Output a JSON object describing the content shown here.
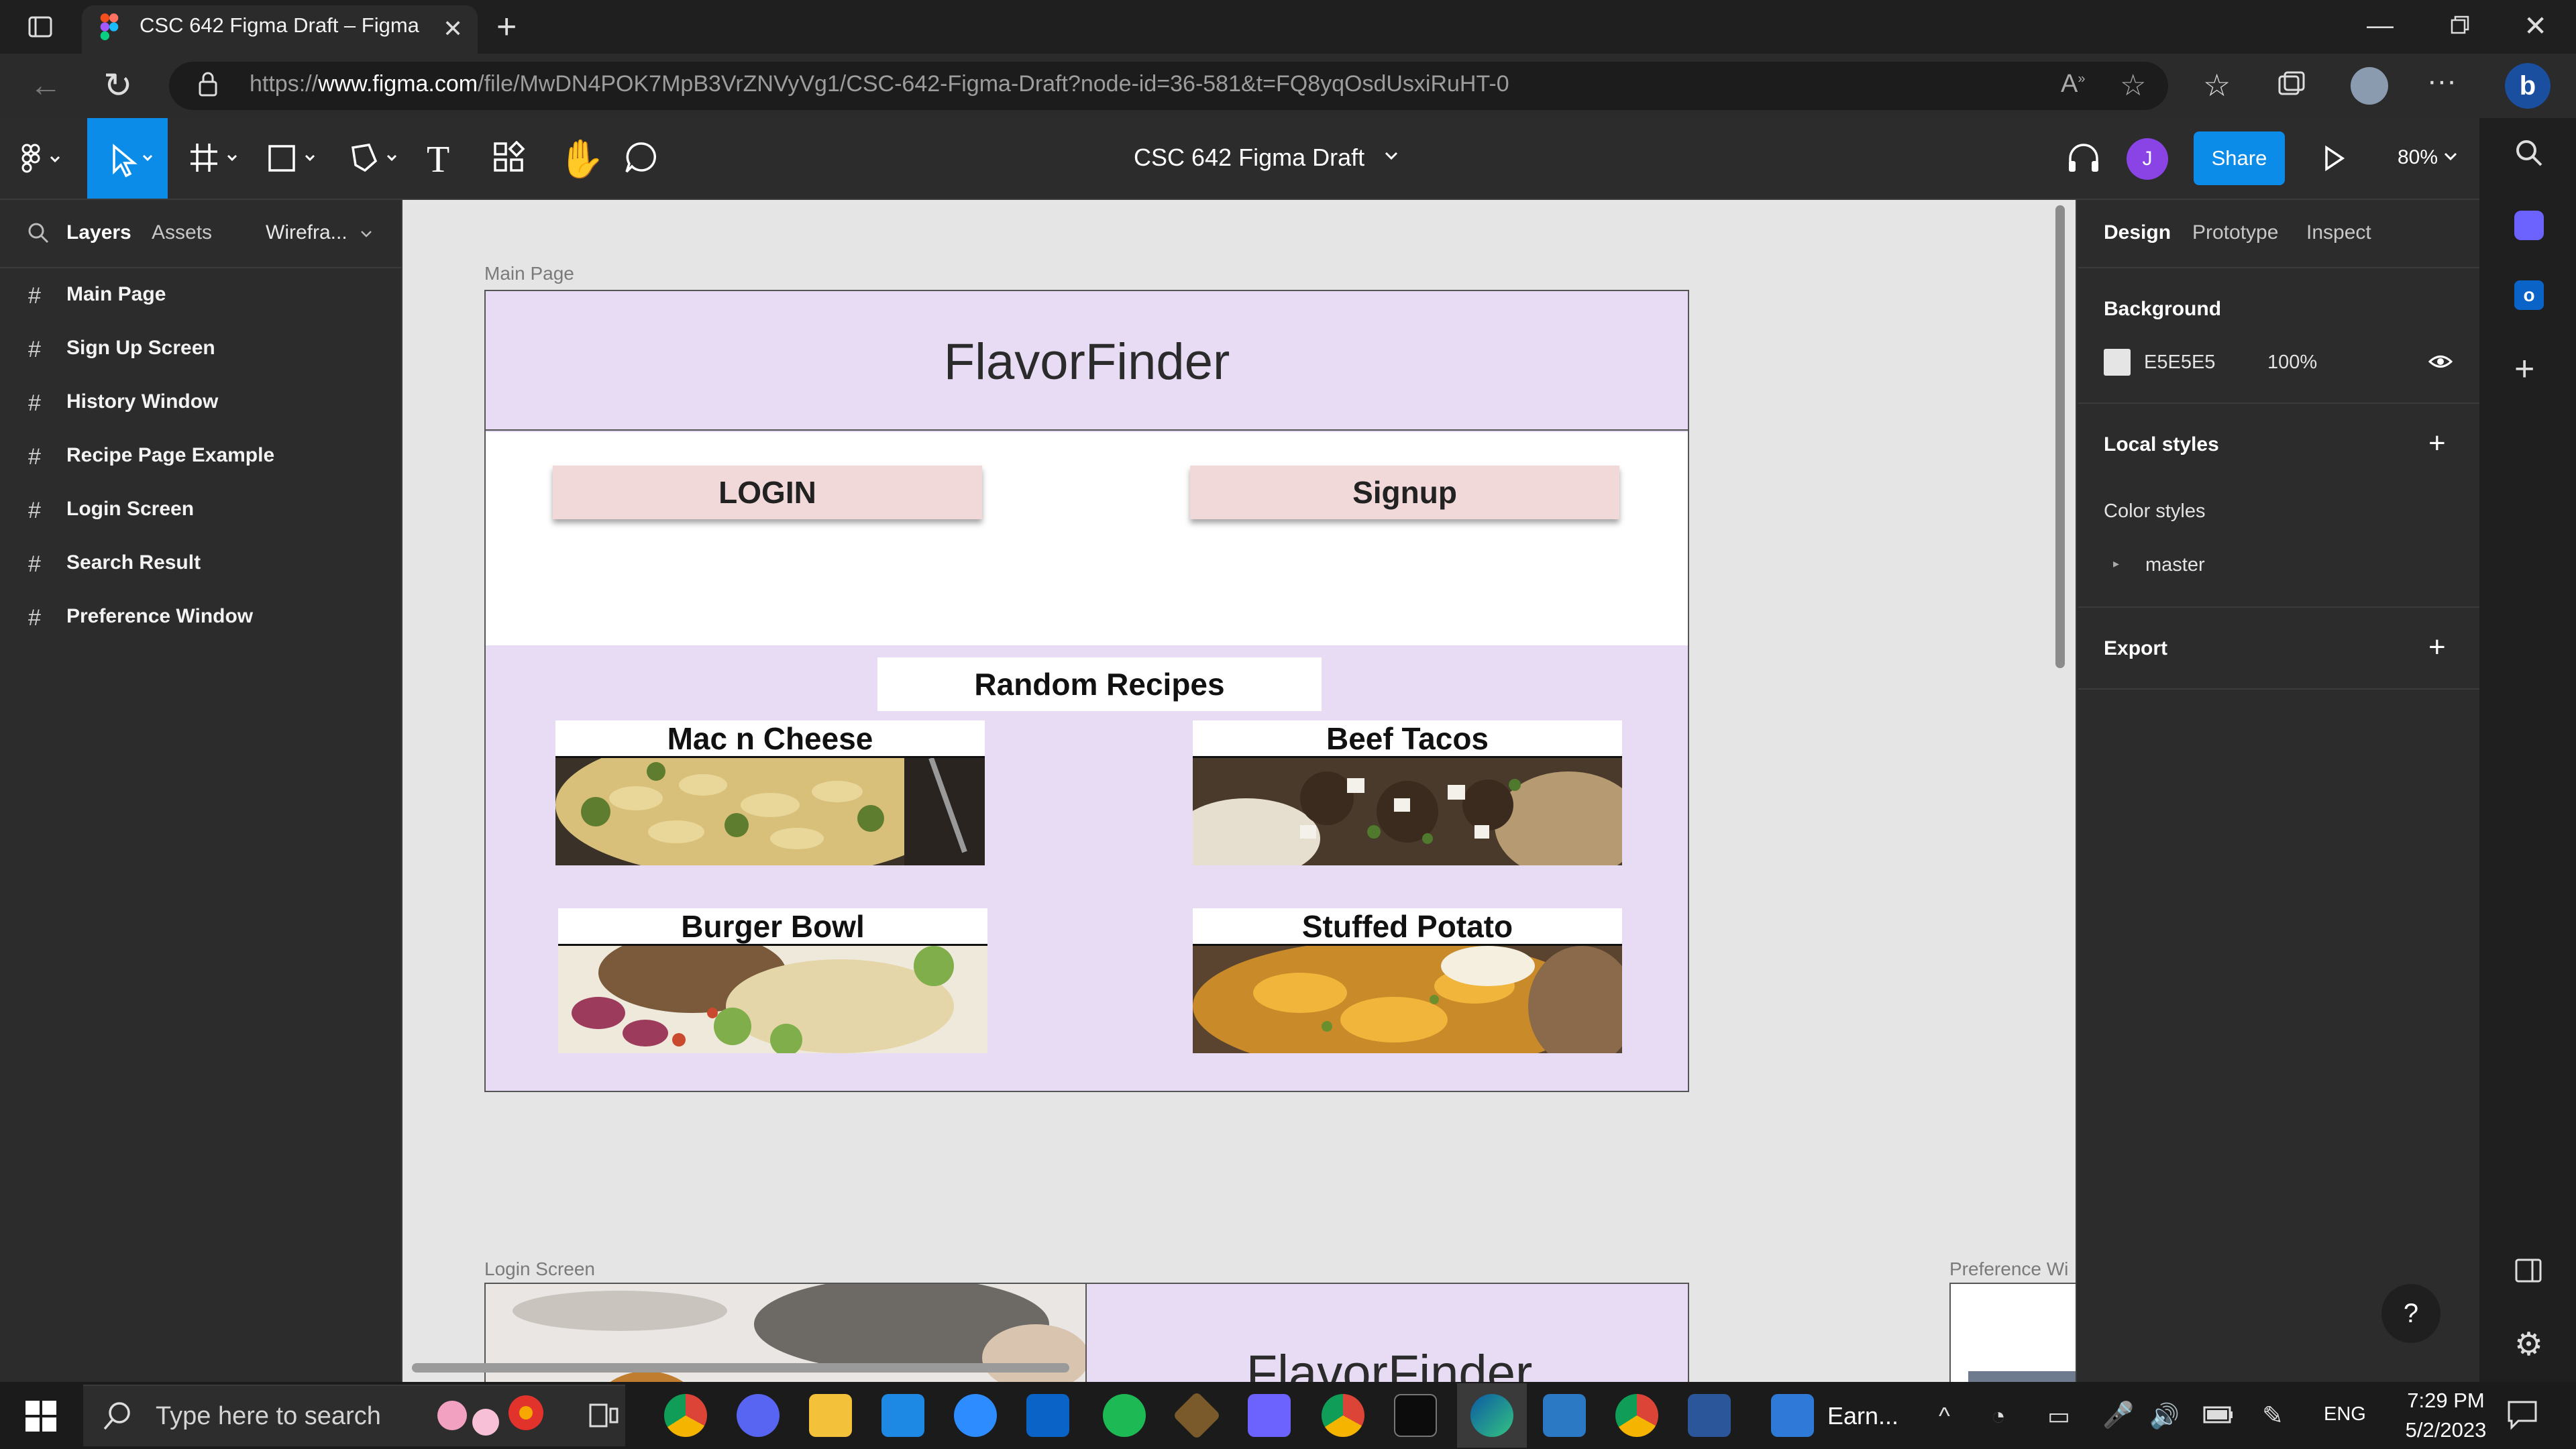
{
  "browser": {
    "tab_title": "CSC 642 Figma Draft – Figma",
    "url_prefix": "https://",
    "url_host": "www.figma.com",
    "url_path": "/file/MwDN4POK7MpB3VrZNVyVg1/CSC-642-Figma-Draft?node-id=36-581&t=FQ8yqOsdUsxiRuHT-0"
  },
  "toolbar": {
    "doc_title": "CSC 642 Figma Draft",
    "user_initial": "J",
    "share_label": "Share",
    "zoom_label": "80%"
  },
  "left_panel": {
    "tabs": [
      "Layers",
      "Assets"
    ],
    "page_selector": "Wirefra...",
    "layers": [
      "Main Page",
      "Sign Up Screen",
      "History Window",
      "Recipe Page Example",
      "Login Screen",
      "Search Result",
      "Preference Window"
    ]
  },
  "canvas": {
    "main_frame_label": "Main Page",
    "login_frame_label": "Login Screen",
    "pref_frame_label": "Preference Wi",
    "app_title": "FlavorFinder",
    "login_button": "LOGIN",
    "signup_button": "Signup",
    "random_recipes_title": "Random Recipes",
    "recipes": [
      {
        "name": "Mac n Cheese",
        "image": "mac-n-cheese-photo"
      },
      {
        "name": "Beef Tacos",
        "image": "beef-tacos-photo"
      },
      {
        "name": "Burger Bowl",
        "image": "burger-bowl-photo"
      },
      {
        "name": "Stuffed Potato",
        "image": "stuffed-potato-photo"
      }
    ],
    "login_frame_title": "FlavorFinder"
  },
  "right_panel": {
    "tabs": [
      "Design",
      "Prototype",
      "Inspect"
    ],
    "background_label": "Background",
    "bg_color_hex": "E5E5E5",
    "bg_opacity": "100%",
    "local_styles_label": "Local styles",
    "color_styles_label": "Color styles",
    "color_style_item": "master",
    "export_label": "Export"
  },
  "taskbar": {
    "search_placeholder": "Type here to search",
    "pinned_label": "Earn...",
    "language": "ENG",
    "time": "7:29 PM",
    "date": "5/2/2023"
  },
  "colors": {
    "figma_blue": "#0c8ce9",
    "frame_lavender": "#e8dcf5",
    "button_pink": "#f1d9d9",
    "canvas_bg": "#e5e5e5",
    "panel_dark": "#2c2c2c"
  }
}
